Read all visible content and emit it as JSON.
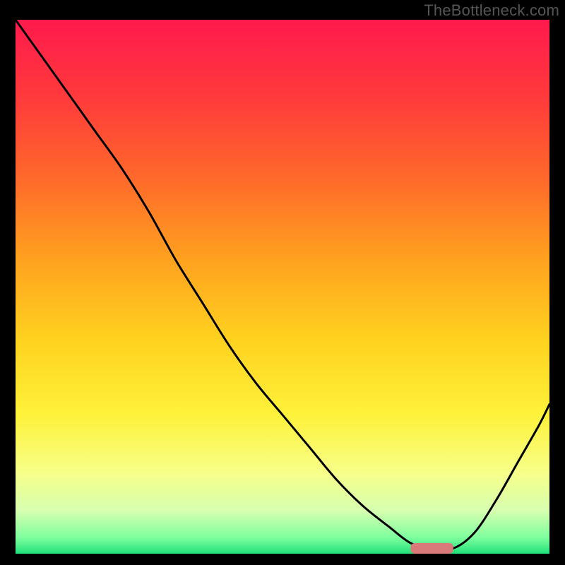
{
  "watermark": "TheBottleneck.com",
  "chart_data": {
    "type": "line",
    "title": "",
    "xlabel": "",
    "ylabel": "",
    "xlim": [
      0,
      100
    ],
    "ylim": [
      0,
      100
    ],
    "x": [
      0,
      5,
      10,
      15,
      20,
      25,
      30,
      35,
      40,
      45,
      50,
      55,
      60,
      65,
      70,
      74,
      78,
      82,
      86,
      90,
      94,
      98,
      100
    ],
    "values": [
      100,
      93,
      86,
      79,
      72,
      64,
      55,
      47,
      39,
      32,
      26,
      20,
      14,
      9,
      5,
      2,
      1,
      1,
      4,
      10,
      17,
      24,
      28
    ],
    "marker": {
      "x": 78,
      "y": 1,
      "width": 8,
      "height": 2
    },
    "gradient_stops": [
      {
        "offset": 0.0,
        "color": "#ff1a4d"
      },
      {
        "offset": 0.15,
        "color": "#ff3b3b"
      },
      {
        "offset": 0.3,
        "color": "#ff6a2a"
      },
      {
        "offset": 0.45,
        "color": "#ffa21f"
      },
      {
        "offset": 0.6,
        "color": "#ffd21f"
      },
      {
        "offset": 0.74,
        "color": "#fff23a"
      },
      {
        "offset": 0.85,
        "color": "#f6ff8a"
      },
      {
        "offset": 0.92,
        "color": "#d6ffb0"
      },
      {
        "offset": 0.97,
        "color": "#7eff9e"
      },
      {
        "offset": 1.0,
        "color": "#20e07a"
      }
    ]
  }
}
